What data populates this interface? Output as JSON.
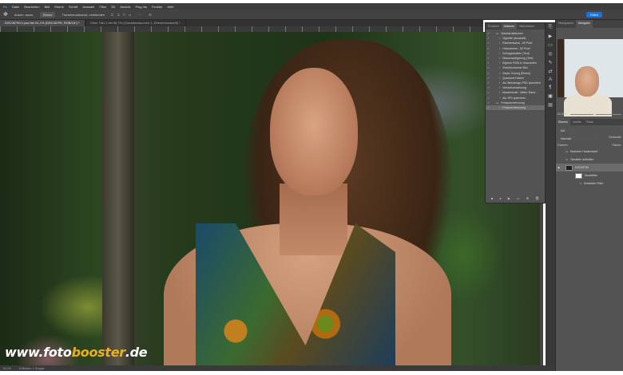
{
  "menu": [
    "Datei",
    "Bearbeiten",
    "Bild",
    "Ebene",
    "Schrift",
    "Auswahl",
    "Filter",
    "3D",
    "Ansicht",
    "Plug-ins",
    "Fenster",
    "Hilfe"
  ],
  "options": {
    "autoselect": "Autom. ausw.",
    "layer_select": "Ebene",
    "transform": "Transformationsst. einblenden",
    "share": "Teilen"
  },
  "tabs": [
    {
      "label": "DSC06799-1.psd bei 61,1% (DSC06799, RGB/16*) *",
      "active": true
    },
    {
      "label": "Ohne Titel-1 bei 66,7% (Gradationskurven 1, Ebenenmaske/8) *",
      "active": false
    }
  ],
  "watermark": {
    "prefix": "www.foto",
    "highlight": "booster",
    "suffix": ".de",
    "highlight_color": "#e8b023"
  },
  "status": {
    "zoom": "61,1%",
    "info": "6 Ebenen, 1 Gruppe"
  },
  "history": {
    "tabs": [
      "Protokoll",
      "Aktionen",
      "Bibliotheken"
    ],
    "items": [
      "Standardaktionen",
      "Vignette (Auswahl)",
      "Rahmenkanal - 50 Pixel",
      "Holzrahmen - 50 Pixel",
      "Schlagschatten (Text)",
      "Wasserspiegelung (Text)",
      "Eigener RGB in Graustufen",
      "Geschmolzener Blei",
      "Sepia-Tonung (Ebene)",
      "Quadrant-Farben",
      "Als Webdesign-PSD speichern",
      "Verlaufsumsetzung",
      "Maskenmatt - Mittel, Rand...",
      "Als JPG speichern",
      "Freiquenztrennung",
      "Frequenztrennung"
    ],
    "selected_index": 15
  },
  "right": {
    "tabs": [
      "Histogramm",
      "Navigator"
    ],
    "zoom": "61,07%",
    "layer_tabs": [
      "Ebenen",
      "Kanäle",
      "Pfade"
    ],
    "kind": "Art",
    "blend": "Normal",
    "opacity_label": "Deckkraft:",
    "lock_label": "Fixieren:",
    "fill_label": "Fläche:",
    "layers": [
      {
        "name": "Besserer Hauttonwert",
        "type": "group"
      },
      {
        "name": "Schatten aufhellen",
        "type": "group"
      },
      {
        "name": "DSC06799",
        "type": "smart",
        "selected": true
      },
      {
        "name": "Smartfilter",
        "type": "filter"
      },
      {
        "name": "Selektiver Filter",
        "type": "filter-item"
      }
    ]
  }
}
